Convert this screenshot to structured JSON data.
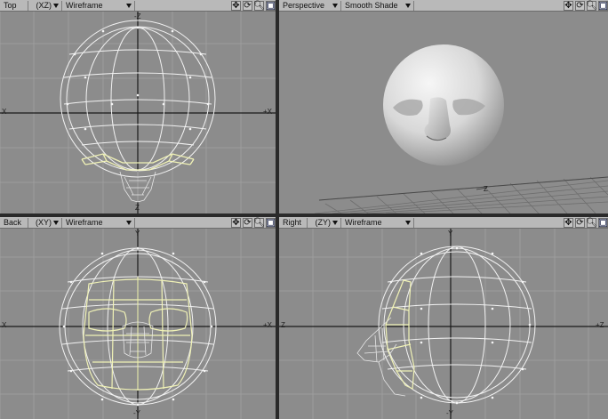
{
  "viewports": {
    "top": {
      "view_label": "Top",
      "axes_label": "(XZ)",
      "mode_label": "Wireframe",
      "axis_left": "X",
      "axis_right": "+X",
      "axis_top": "-Z",
      "axis_bottom": "Z"
    },
    "perspective": {
      "view_label": "Perspective",
      "mode_label": "Smooth Shade",
      "axis_label": "Z"
    },
    "back": {
      "view_label": "Back",
      "axes_label": "(XY)",
      "mode_label": "Wireframe",
      "axis_left": "X",
      "axis_right": "+X",
      "axis_top": "Y",
      "axis_bottom": "-Y"
    },
    "right": {
      "view_label": "Right",
      "axes_label": "(ZY)",
      "mode_label": "Wireframe",
      "axis_left": "Z",
      "axis_right": "+Z",
      "axis_top": "Y",
      "axis_bottom": "-Y"
    }
  },
  "icons": [
    "move-view-icon",
    "rotate-view-icon",
    "zoom-view-icon",
    "maximize-viewport-icon"
  ],
  "colors": {
    "viewport_bg": "#8c8c8c",
    "grid": "#9c9c9c",
    "wire": "#f2f2f2",
    "selected_wire": "#f0f2b6",
    "header_bg": "#b9b9b9"
  }
}
